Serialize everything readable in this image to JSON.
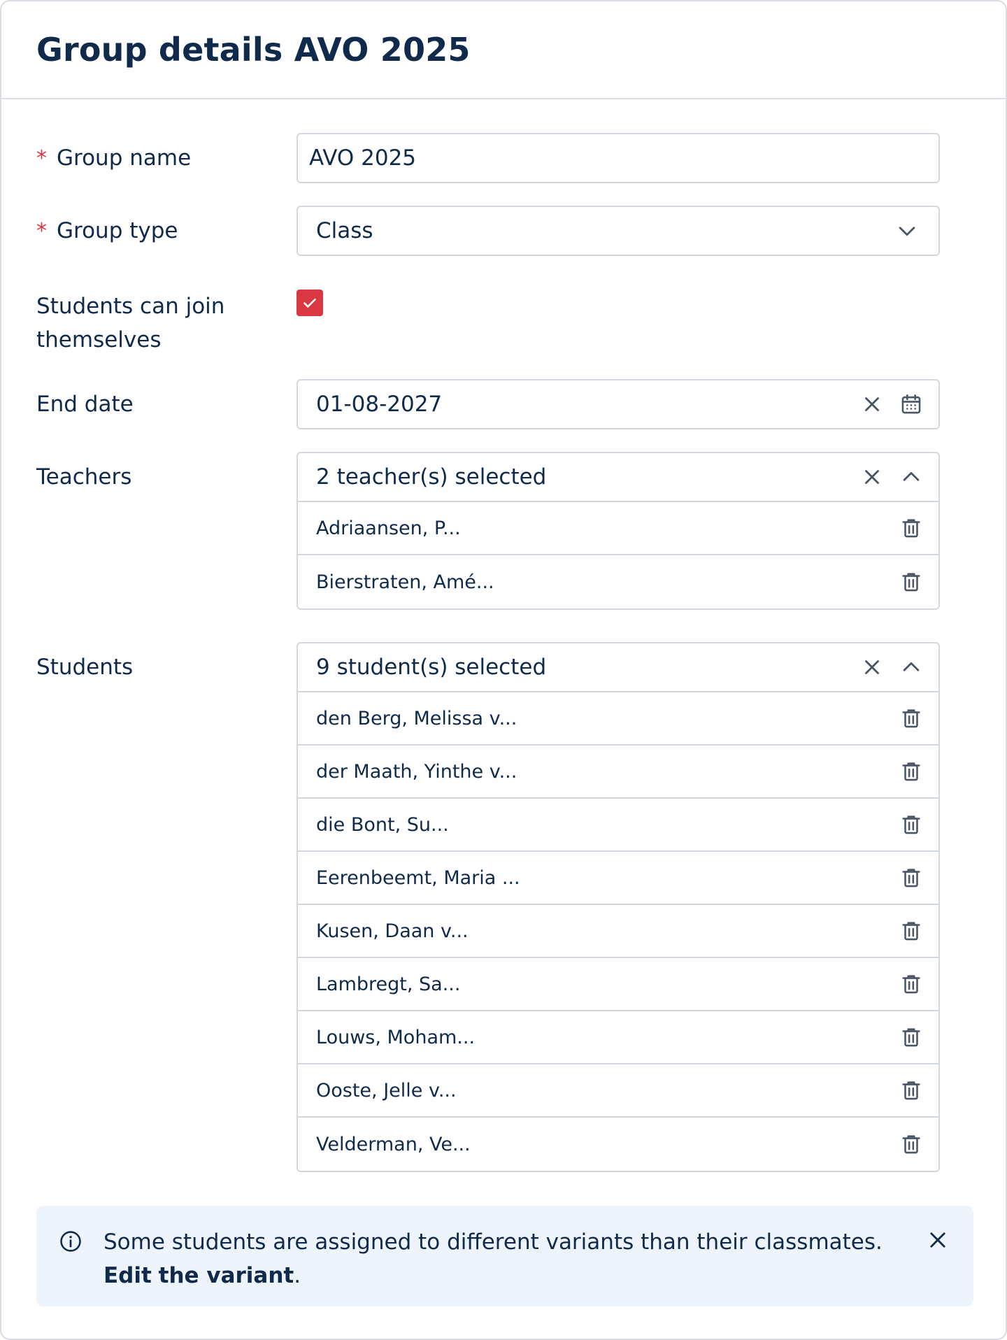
{
  "header": {
    "title": "Group details AVO 2025"
  },
  "form": {
    "group_name": {
      "label": "Group name",
      "value": "AVO 2025",
      "required_mark": "*"
    },
    "group_type": {
      "label": "Group type",
      "value": "Class",
      "required_mark": "*"
    },
    "self_join": {
      "label_line1": "Students can join",
      "label_line2": "themselves",
      "checked": true
    },
    "end_date": {
      "label": "End date",
      "value": "01-08-2027"
    },
    "teachers": {
      "label": "Teachers",
      "summary": "2 teacher(s) selected",
      "items": [
        "Adriaansen, P...",
        "Bierstraten, Amé..."
      ]
    },
    "students": {
      "label": "Students",
      "summary": "9 student(s) selected",
      "items": [
        "den Berg, Melissa v...",
        "der Maath, Yinthe v...",
        "die Bont, Su...",
        "Eerenbeemt, Maria ...",
        "Kusen, Daan v...",
        "Lambregt, Sa...",
        "Louws, Moham...",
        "Ooste, Jelle v...",
        "Velderman, Ve..."
      ]
    }
  },
  "alert": {
    "text": "Some students are assigned to different variants than their classmates.",
    "link_part1": "Edit",
    "link_part2": "the variant",
    "end": "."
  },
  "colors": {
    "accent": "#d93842",
    "text": "#0f2a4a",
    "alert_bg": "#eef4fc",
    "border": "#d3d8de"
  }
}
